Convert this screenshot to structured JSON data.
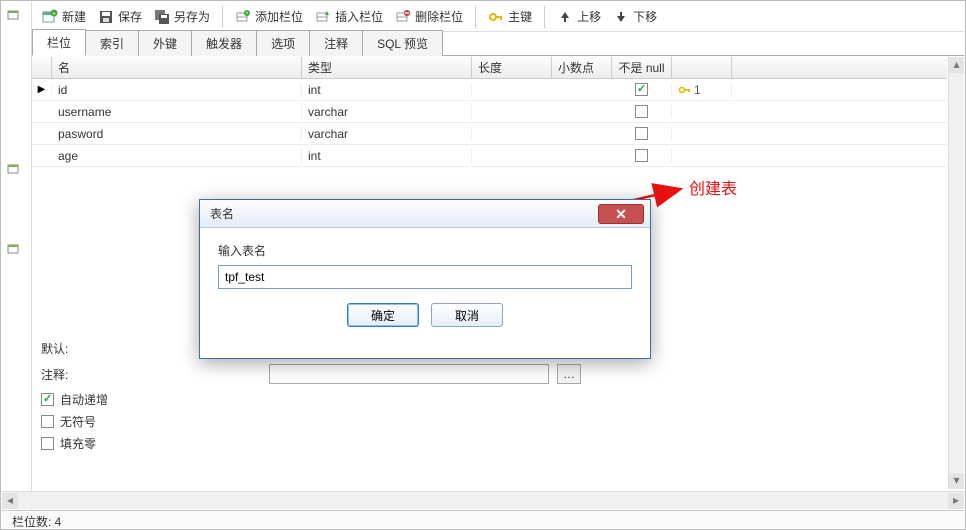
{
  "toolbar": {
    "new": "新建",
    "save": "保存",
    "save_as": "另存为",
    "add_field": "添加栏位",
    "insert_field": "插入栏位",
    "delete_field": "删除栏位",
    "primary_key": "主键",
    "move_up": "上移",
    "move_down": "下移"
  },
  "tabs": {
    "fields": "栏位",
    "indexes": "索引",
    "foreign_keys": "外键",
    "triggers": "触发器",
    "options": "选项",
    "comment": "注释",
    "sql_preview": "SQL 预览"
  },
  "grid": {
    "headers": {
      "name": "名",
      "type": "类型",
      "length": "长度",
      "decimals": "小数点",
      "not_null": "不是 null"
    },
    "rows": [
      {
        "name": "id",
        "type": "int",
        "length": "",
        "decimals": "",
        "not_null": true,
        "is_key": true,
        "key_index": "1",
        "current": true
      },
      {
        "name": "username",
        "type": "varchar",
        "length": "",
        "decimals": "",
        "not_null": false,
        "is_key": false
      },
      {
        "name": "pasword",
        "type": "varchar",
        "length": "",
        "decimals": "",
        "not_null": false,
        "is_key": false
      },
      {
        "name": "age",
        "type": "int",
        "length": "",
        "decimals": "",
        "not_null": false,
        "is_key": false
      }
    ]
  },
  "lower_form": {
    "default_label": "默认:",
    "comment_label": "注释:",
    "auto_increment_label": "自动递增",
    "auto_increment_checked": true,
    "unsigned_label": "无符号",
    "unsigned_checked": false,
    "zerofill_label": "填充零",
    "zerofill_checked": false
  },
  "dialog": {
    "title": "表名",
    "prompt": "输入表名",
    "value": "tpf_test",
    "ok": "确定",
    "cancel": "取消"
  },
  "annotation": "创建表",
  "statusbar": "栏位数: 4"
}
